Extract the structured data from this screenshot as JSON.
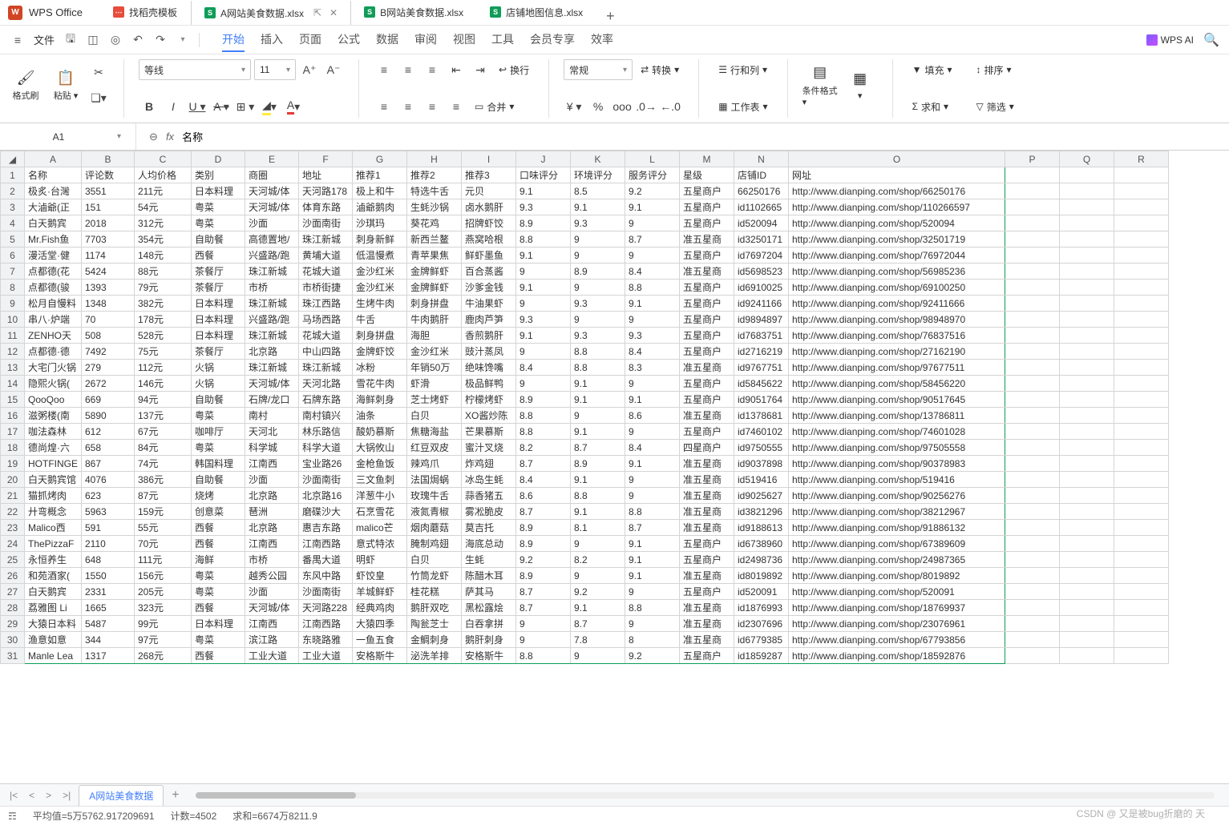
{
  "app": {
    "name": "WPS Office"
  },
  "title_tabs": {
    "search": "找稻壳模板",
    "active": "A网站美食数据.xlsx",
    "others": [
      "B网站美食数据.xlsx",
      "店铺地图信息.xlsx"
    ]
  },
  "menu": {
    "file": "文件",
    "tabs": [
      "开始",
      "插入",
      "页面",
      "公式",
      "数据",
      "审阅",
      "视图",
      "工具",
      "会员专享",
      "效率"
    ],
    "active_index": 0,
    "ai": "WPS AI"
  },
  "ribbon": {
    "format_brush": "格式刷",
    "paste": "粘贴",
    "font_family": "等线",
    "font_size": "11",
    "number_format": "常规",
    "wrap": "换行",
    "merge": "合并",
    "convert": "转换",
    "rows_cols": "行和列",
    "worksheet": "工作表",
    "cond_fmt": "条件格式",
    "fill": "填充",
    "sort": "排序",
    "sum": "求和",
    "filter": "筛选"
  },
  "name_box": {
    "value": "A1"
  },
  "formula_bar": {
    "value": "名称"
  },
  "columns": [
    "A",
    "B",
    "C",
    "D",
    "E",
    "F",
    "G",
    "H",
    "I",
    "J",
    "K",
    "L",
    "M",
    "N",
    "O",
    "P",
    "Q",
    "R"
  ],
  "headers": [
    "名称",
    "评论数",
    "人均价格",
    "类别",
    "商圈",
    "地址",
    "推荐1",
    "推荐2",
    "推荐3",
    "口味评分",
    "环境评分",
    "服务评分",
    "星级",
    "店铺ID",
    "网址"
  ],
  "rows": [
    {
      "r": 2,
      "名称": "极炙·台灣",
      "评论数": 3551,
      "人均价格": "211元",
      "类别": "日本料理",
      "商圈": "天河城/体",
      "地址": "天河路178",
      "推荐1": "极上和牛",
      "推荐2": "特选牛舌",
      "推荐3": "元贝",
      "口味评分": 9.1,
      "环境评分": 8.5,
      "服务评分": 9.2,
      "星级": "五星商户",
      "店铺ID": "66250176",
      "网址": "http://www.dianping.com/shop/66250176"
    },
    {
      "r": 3,
      "名称": "大滷爺(正",
      "评论数": 151,
      "人均价格": "54元",
      "类别": "粤菜",
      "商圈": "天河城/体",
      "地址": "体育东路",
      "推荐1": "滷爺鹅肉",
      "推荐2": "生蚝沙锅",
      "推荐3": "卤水鹅肝",
      "口味评分": 9.3,
      "环境评分": 9.1,
      "服务评分": 9.1,
      "星级": "五星商户",
      "店铺ID": "id1102665",
      "网址": "http://www.dianping.com/shop/110266597"
    },
    {
      "r": 4,
      "名称": "白天鹅宾",
      "评论数": 2018,
      "人均价格": "312元",
      "类别": "粤菜",
      "商圈": "沙面",
      "地址": "沙面南街",
      "推荐1": "沙琪玛",
      "推荐2": "葵花鸡",
      "推荐3": "招牌虾饺",
      "口味评分": 8.9,
      "环境评分": 9.3,
      "服务评分": 9,
      "星级": "五星商户",
      "店铺ID": "id520094",
      "网址": "http://www.dianping.com/shop/520094"
    },
    {
      "r": 5,
      "名称": "Mr.Fish鱼",
      "评论数": 7703,
      "人均价格": "354元",
      "类别": "自助餐",
      "商圈": "高德置地/",
      "地址": "珠江新城",
      "推荐1": "刺身新鲜",
      "推荐2": "新西兰鳌",
      "推荐3": "燕窝哈根",
      "口味评分": 8.8,
      "环境评分": 9,
      "服务评分": 8.7,
      "星级": "准五星商",
      "店铺ID": "id3250171",
      "网址": "http://www.dianping.com/shop/32501719"
    },
    {
      "r": 6,
      "名称": "漫活堂·健",
      "评论数": 1174,
      "人均价格": "148元",
      "类别": "西餐",
      "商圈": "兴盛路/跑",
      "地址": "黄埔大道",
      "推荐1": "低温慢煮",
      "推荐2": "青苹果焦",
      "推荐3": "鲜虾墨鱼",
      "口味评分": 9.1,
      "环境评分": 9,
      "服务评分": 9,
      "星级": "五星商户",
      "店铺ID": "id7697204",
      "网址": "http://www.dianping.com/shop/76972044"
    },
    {
      "r": 7,
      "名称": "点都德(花",
      "评论数": 5424,
      "人均价格": "88元",
      "类别": "茶餐厅",
      "商圈": "珠江新城",
      "地址": "花城大道",
      "推荐1": "金沙红米",
      "推荐2": "金牌鲜虾",
      "推荐3": "百合蒸酱",
      "口味评分": 9,
      "环境评分": 8.9,
      "服务评分": 8.4,
      "星级": "准五星商",
      "店铺ID": "id5698523",
      "网址": "http://www.dianping.com/shop/56985236"
    },
    {
      "r": 8,
      "名称": "点都德(骏",
      "评论数": 1393,
      "人均价格": "79元",
      "类别": "茶餐厅",
      "商圈": "市桥",
      "地址": "市桥街捷",
      "推荐1": "金沙红米",
      "推荐2": "金牌鲜虾",
      "推荐3": "沙爹金钱",
      "口味评分": 9.1,
      "环境评分": 9,
      "服务评分": 8.8,
      "星级": "五星商户",
      "店铺ID": "id6910025",
      "网址": "http://www.dianping.com/shop/69100250"
    },
    {
      "r": 9,
      "名称": "松月自慢料",
      "评论数": 1348,
      "人均价格": "382元",
      "类别": "日本料理",
      "商圈": "珠江新城",
      "地址": "珠江西路",
      "推荐1": "生烤牛肉",
      "推荐2": "刺身拼盘",
      "推荐3": "牛油果虾",
      "口味评分": 9,
      "环境评分": 9.3,
      "服务评分": 9.1,
      "星级": "五星商户",
      "店铺ID": "id9241166",
      "网址": "http://www.dianping.com/shop/92411666"
    },
    {
      "r": 10,
      "名称": "串八·炉端",
      "评论数": 70,
      "人均价格": "178元",
      "类别": "日本料理",
      "商圈": "兴盛路/跑",
      "地址": "马场西路",
      "推荐1": "牛舌",
      "推荐2": "牛肉鹅肝",
      "推荐3": "鹿肉芦笋",
      "口味评分": 9.3,
      "环境评分": 9,
      "服务评分": 9,
      "星级": "五星商户",
      "店铺ID": "id9894897",
      "网址": "http://www.dianping.com/shop/98948970"
    },
    {
      "r": 11,
      "名称": "ZENHO天",
      "评论数": 508,
      "人均价格": "528元",
      "类别": "日本料理",
      "商圈": "珠江新城",
      "地址": "花城大道",
      "推荐1": "刺身拼盘",
      "推荐2": "海胆",
      "推荐3": "香煎鹅肝",
      "口味评分": 9.1,
      "环境评分": 9.3,
      "服务评分": 9.3,
      "星级": "五星商户",
      "店铺ID": "id7683751",
      "网址": "http://www.dianping.com/shop/76837516"
    },
    {
      "r": 12,
      "名称": "点都德·德",
      "评论数": 7492,
      "人均价格": "75元",
      "类别": "茶餐厅",
      "商圈": "北京路",
      "地址": "中山四路",
      "推荐1": "金牌虾饺",
      "推荐2": "金沙红米",
      "推荐3": "豉汁蒸凤",
      "口味评分": 9,
      "环境评分": 8.8,
      "服务评分": 8.4,
      "星级": "五星商户",
      "店铺ID": "id2716219",
      "网址": "http://www.dianping.com/shop/27162190"
    },
    {
      "r": 13,
      "名称": "大宅门火锅",
      "评论数": 279,
      "人均价格": "112元",
      "类别": "火锅",
      "商圈": "珠江新城",
      "地址": "珠江新城",
      "推荐1": "冰粉",
      "推荐2": "年销50万",
      "推荐3": "绝味馋嘴",
      "口味评分": 8.4,
      "环境评分": 8.8,
      "服务评分": 8.3,
      "星级": "准五星商",
      "店铺ID": "id9767751",
      "网址": "http://www.dianping.com/shop/97677511"
    },
    {
      "r": 14,
      "名称": "隐熙火锅(",
      "评论数": 2672,
      "人均价格": "146元",
      "类别": "火锅",
      "商圈": "天河城/体",
      "地址": "天河北路",
      "推荐1": "雪花牛肉",
      "推荐2": "虾滑",
      "推荐3": "极品鲜鸭",
      "口味评分": 9,
      "环境评分": 9.1,
      "服务评分": 9,
      "星级": "五星商户",
      "店铺ID": "id5845622",
      "网址": "http://www.dianping.com/shop/58456220"
    },
    {
      "r": 15,
      "名称": "QooQoo",
      "评论数": 669,
      "人均价格": "94元",
      "类别": "自助餐",
      "商圈": "石牌/龙口",
      "地址": "石牌东路",
      "推荐1": "海鲜刺身",
      "推荐2": "芝士烤虾",
      "推荐3": "柠檬烤虾",
      "口味评分": 8.9,
      "环境评分": 9.1,
      "服务评分": 9.1,
      "星级": "五星商户",
      "店铺ID": "id9051764",
      "网址": "http://www.dianping.com/shop/90517645"
    },
    {
      "r": 16,
      "名称": "滋粥楼(南",
      "评论数": 5890,
      "人均价格": "137元",
      "类别": "粤菜",
      "商圈": "南村",
      "地址": "南村镇兴",
      "推荐1": "油条",
      "推荐2": "白贝",
      "推荐3": "XO酱炒陈",
      "口味评分": 8.8,
      "环境评分": 9,
      "服务评分": 8.6,
      "星级": "准五星商",
      "店铺ID": "id1378681",
      "网址": "http://www.dianping.com/shop/13786811"
    },
    {
      "r": 17,
      "名称": "咖法森林",
      "评论数": 612,
      "人均价格": "67元",
      "类别": "咖啡厅",
      "商圈": "天河北",
      "地址": "林乐路信",
      "推荐1": "酸奶慕斯",
      "推荐2": "焦糖海盐",
      "推荐3": "芒果慕斯",
      "口味评分": 8.8,
      "环境评分": 9.1,
      "服务评分": 9,
      "星级": "五星商户",
      "店铺ID": "id7460102",
      "网址": "http://www.dianping.com/shop/74601028"
    },
    {
      "r": 18,
      "名称": "德尚煌·六",
      "评论数": 658,
      "人均价格": "84元",
      "类别": "粤菜",
      "商圈": "科学城",
      "地址": "科学大道",
      "推荐1": "大锅攸山",
      "推荐2": "红豆双皮",
      "推荐3": "蜜汁叉烧",
      "口味评分": 8.2,
      "环境评分": 8.7,
      "服务评分": 8.4,
      "星级": "四星商户",
      "店铺ID": "id9750555",
      "网址": "http://www.dianping.com/shop/97505558"
    },
    {
      "r": 19,
      "名称": "HOTFINGE",
      "评论数": 867,
      "人均价格": "74元",
      "类别": "韩国料理",
      "商圈": "江南西",
      "地址": "宝业路26",
      "推荐1": "金枪鱼饭",
      "推荐2": "辣鸡爪",
      "推荐3": "炸鸡翅",
      "口味评分": 8.7,
      "环境评分": 8.9,
      "服务评分": 9.1,
      "星级": "准五星商",
      "店铺ID": "id9037898",
      "网址": "http://www.dianping.com/shop/90378983"
    },
    {
      "r": 20,
      "名称": "白天鹅宾馆",
      "评论数": 4076,
      "人均价格": "386元",
      "类别": "自助餐",
      "商圈": "沙面",
      "地址": "沙面南街",
      "推荐1": "三文鱼刺",
      "推荐2": "法国焗蜗",
      "推荐3": "冰岛生蚝",
      "口味评分": 8.4,
      "环境评分": 9.1,
      "服务评分": 9,
      "星级": "准五星商",
      "店铺ID": "id519416",
      "网址": "http://www.dianping.com/shop/519416"
    },
    {
      "r": 21,
      "名称": "猫抓烤肉",
      "评论数": 623,
      "人均价格": "87元",
      "类别": "烧烤",
      "商圈": "北京路",
      "地址": "北京路16",
      "推荐1": "洋葱牛小",
      "推荐2": "玫瑰牛舌",
      "推荐3": "蒜香猪五",
      "口味评分": 8.6,
      "环境评分": 8.8,
      "服务评分": 9,
      "星级": "准五星商",
      "店铺ID": "id9025627",
      "网址": "http://www.dianping.com/shop/90256276"
    },
    {
      "r": 22,
      "名称": "廾弯概念",
      "评论数": 5963,
      "人均价格": "159元",
      "类别": "创意菜",
      "商圈": "琶洲",
      "地址": "磨碟沙大",
      "推荐1": "石烹雪花",
      "推荐2": "液氮青椒",
      "推荐3": "雾凇脆皮",
      "口味评分": 8.7,
      "环境评分": 9.1,
      "服务评分": 8.8,
      "星级": "准五星商",
      "店铺ID": "id3821296",
      "网址": "http://www.dianping.com/shop/38212967"
    },
    {
      "r": 23,
      "名称": "Malico西",
      "评论数": 591,
      "人均价格": "55元",
      "类别": "西餐",
      "商圈": "北京路",
      "地址": "惠吉东路",
      "推荐1": "malico芒",
      "推荐2": "烟肉蘑菇",
      "推荐3": "莫吉托",
      "口味评分": 8.9,
      "环境评分": 8.1,
      "服务评分": 8.7,
      "星级": "准五星商",
      "店铺ID": "id9188613",
      "网址": "http://www.dianping.com/shop/91886132"
    },
    {
      "r": 24,
      "名称": "ThePizzaF",
      "评论数": 2110,
      "人均价格": "70元",
      "类别": "西餐",
      "商圈": "江南西",
      "地址": "江南西路",
      "推荐1": "意式特浓",
      "推荐2": "腌制鸡翅",
      "推荐3": "海底总动",
      "口味评分": 8.9,
      "环境评分": 9,
      "服务评分": 9.1,
      "星级": "五星商户",
      "店铺ID": "id6738960",
      "网址": "http://www.dianping.com/shop/67389609"
    },
    {
      "r": 25,
      "名称": "永恒养生",
      "评论数": 648,
      "人均价格": "111元",
      "类别": "海鲜",
      "商圈": "市桥",
      "地址": "番禺大道",
      "推荐1": "明虾",
      "推荐2": "白贝",
      "推荐3": "生蚝",
      "口味评分": 9.2,
      "环境评分": 8.2,
      "服务评分": 9.1,
      "星级": "五星商户",
      "店铺ID": "id2498736",
      "网址": "http://www.dianping.com/shop/24987365"
    },
    {
      "r": 26,
      "名称": "和苑酒家(",
      "评论数": 1550,
      "人均价格": "156元",
      "类别": "粤菜",
      "商圈": "越秀公园",
      "地址": "东风中路",
      "推荐1": "虾饺皇",
      "推荐2": "竹筒龙虾",
      "推荐3": "陈醋木耳",
      "口味评分": 8.9,
      "环境评分": 9,
      "服务评分": 9.1,
      "星级": "准五星商",
      "店铺ID": "id8019892",
      "网址": "http://www.dianping.com/shop/8019892"
    },
    {
      "r": 27,
      "名称": "白天鹅宾",
      "评论数": 2331,
      "人均价格": "205元",
      "类别": "粤菜",
      "商圈": "沙面",
      "地址": "沙面南街",
      "推荐1": "羊城鲜虾",
      "推荐2": "桂花糕",
      "推荐3": "萨其马",
      "口味评分": 8.7,
      "环境评分": 9.2,
      "服务评分": 9,
      "星级": "五星商户",
      "店铺ID": "id520091",
      "网址": "http://www.dianping.com/shop/520091"
    },
    {
      "r": 28,
      "名称": "荔雅图 Li",
      "评论数": 1665,
      "人均价格": "323元",
      "类别": "西餐",
      "商圈": "天河城/体",
      "地址": "天河路228",
      "推荐1": "经典鸡肉",
      "推荐2": "鹅肝双吃",
      "推荐3": "黑松露烩",
      "口味评分": 8.7,
      "环境评分": 9.1,
      "服务评分": 8.8,
      "星级": "准五星商",
      "店铺ID": "id1876993",
      "网址": "http://www.dianping.com/shop/18769937"
    },
    {
      "r": 29,
      "名称": "大猿日本料",
      "评论数": 5487,
      "人均价格": "99元",
      "类别": "日本料理",
      "商圈": "江南西",
      "地址": "江南西路",
      "推荐1": "大猿四季",
      "推荐2": "陶瓮芝士",
      "推荐3": "白吞拿拼",
      "口味评分": 9,
      "环境评分": 8.7,
      "服务评分": 9,
      "星级": "准五星商",
      "店铺ID": "id2307696",
      "网址": "http://www.dianping.com/shop/23076961"
    },
    {
      "r": 30,
      "名称": "渔意如意",
      "评论数": 344,
      "人均价格": "97元",
      "类别": "粤菜",
      "商圈": "滨江路",
      "地址": "东晓路雅",
      "推荐1": "一鱼五食",
      "推荐2": "金鲷刺身",
      "推荐3": "鹅肝刺身",
      "口味评分": 9,
      "环境评分": 7.8,
      "服务评分": 8,
      "星级": "准五星商",
      "店铺ID": "id6779385",
      "网址": "http://www.dianping.com/shop/67793856"
    },
    {
      "r": 31,
      "名称": "Manle Lea",
      "评论数": 1317,
      "人均价格": "268元",
      "类别": "西餐",
      "商圈": "工业大道",
      "地址": "工业大道",
      "推荐1": "安格斯牛",
      "推荐2": "泌洗羊排",
      "推荐3": "安格斯牛",
      "口味评分": 8.8,
      "环境评分": 9,
      "服务评分": 9.2,
      "星级": "五星商户",
      "店铺ID": "id1859287",
      "网址": "http://www.dianping.com/shop/18592876"
    }
  ],
  "sheet_tabs": {
    "active": "A网站美食数据"
  },
  "status": {
    "avg_label": "平均值=5万5762.917209691",
    "count_label": "计数=4502",
    "sum_label": "求和=6674万8211.9"
  },
  "watermark": "CSDN @ 又是被bug折磨的    天"
}
